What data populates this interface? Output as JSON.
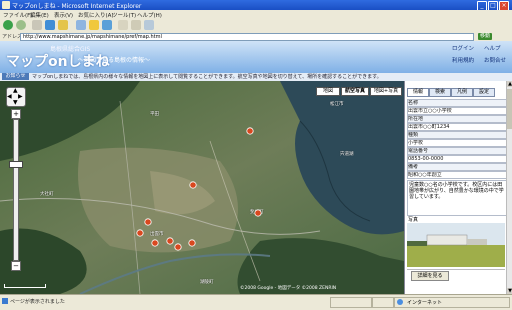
{
  "browser": {
    "title": "マップonしまね - Microsoft Internet Explorer",
    "menu": [
      "ファイル(F)",
      "編集(E)",
      "表示(V)",
      "お気に入り(A)",
      "ツール(T)",
      "ヘルプ(H)"
    ],
    "address_label": "アドレス(D)",
    "address_value": "http://www.mapshimane.jp/mapshimane/pref/map.html",
    "go_label": "移動",
    "window_controls": [
      "minimize-icon",
      "maximize-icon",
      "close-icon"
    ]
  },
  "header": {
    "subtitle": "島根県総合GIS",
    "logo": "マップonしまね",
    "catch": "〜地図で見る島根の情報〜",
    "links": [
      "ログイン",
      "ヘルプ",
      "利用規約",
      "お問合せ"
    ]
  },
  "ticker": {
    "button_label": "お知らせ",
    "text": "マップonしまねでは、島根県内の様々な情報を地図上に表示して閲覧することができます。航空写真や地図を切り替えて、場所を確認することができます。"
  },
  "map": {
    "type_buttons": [
      "地図",
      "航空写真",
      "地図+写真"
    ],
    "place_labels": [
      "出雲市",
      "斐川町",
      "宍道湖",
      "平田",
      "大社町",
      "松江市",
      "湖陵町"
    ],
    "attribution": "©2008 Google - 地図データ ©2008 ZENRIN"
  },
  "sidebar": {
    "tabs": [
      "情報",
      "検索",
      "凡例",
      "設定"
    ],
    "rows": [
      {
        "label": "名称",
        "value": "出雲市立○○小学校"
      },
      {
        "label": "所在地",
        "value": "出雲市○○町1234"
      },
      {
        "label": "種類",
        "value": "小学校"
      },
      {
        "label": "電話番号",
        "value": "0853-00-0000"
      },
      {
        "label": "備考",
        "value": "昭和○○年創立"
      }
    ],
    "description": "児童数○○名の小学校です。校区内には田園地帯が広がり、自然豊かな環境の中で学習しています。",
    "photo_caption": "写真",
    "button_label": "詳細を見る"
  },
  "status": {
    "text": "ページが表示されました",
    "zone": "インターネット"
  },
  "colors": {
    "title_bar": "#1f57cc",
    "header_top": "#cfe3f7",
    "header_bottom": "#7fb0e6",
    "lake": "#2d4a58",
    "marker": "#d9481f"
  }
}
